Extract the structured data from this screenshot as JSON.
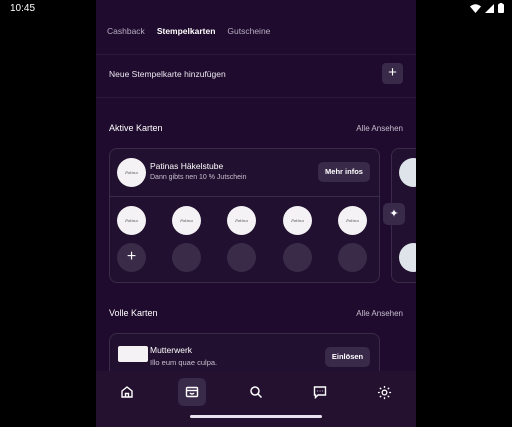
{
  "status_bar": {
    "time": "10:45"
  },
  "tabs": [
    {
      "label": "Cashback"
    },
    {
      "label": "Stempelkarten"
    },
    {
      "label": "Gutscheine"
    }
  ],
  "add_card": {
    "label": "Neue Stempelkarte hinzufügen",
    "icon": "plus-icon"
  },
  "active_section": {
    "title": "Aktive Karten",
    "link": "Alle Ansehen"
  },
  "active_card": {
    "name": "Patinas Häkelstube",
    "subtitle": "Dann gibts nen 10 % Jutschein",
    "button": "Mehr infos",
    "stamps_filled": 5,
    "stamps_total": 10
  },
  "full_section": {
    "title": "Volle Karten",
    "link": "Alle Ansehen"
  },
  "full_card": {
    "name": "Mutterwerk",
    "subtitle": "Illo eum quae culpa.",
    "button": "Einlösen"
  },
  "bottom_nav": [
    {
      "icon": "home-icon"
    },
    {
      "icon": "stamp-card-icon"
    },
    {
      "icon": "search-icon"
    },
    {
      "icon": "chat-icon"
    },
    {
      "icon": "settings-icon"
    }
  ],
  "colors": {
    "background": "#1f0b2e",
    "card": "#21102f",
    "button": "#3a2a4a",
    "text_muted": "#c8bed0"
  }
}
